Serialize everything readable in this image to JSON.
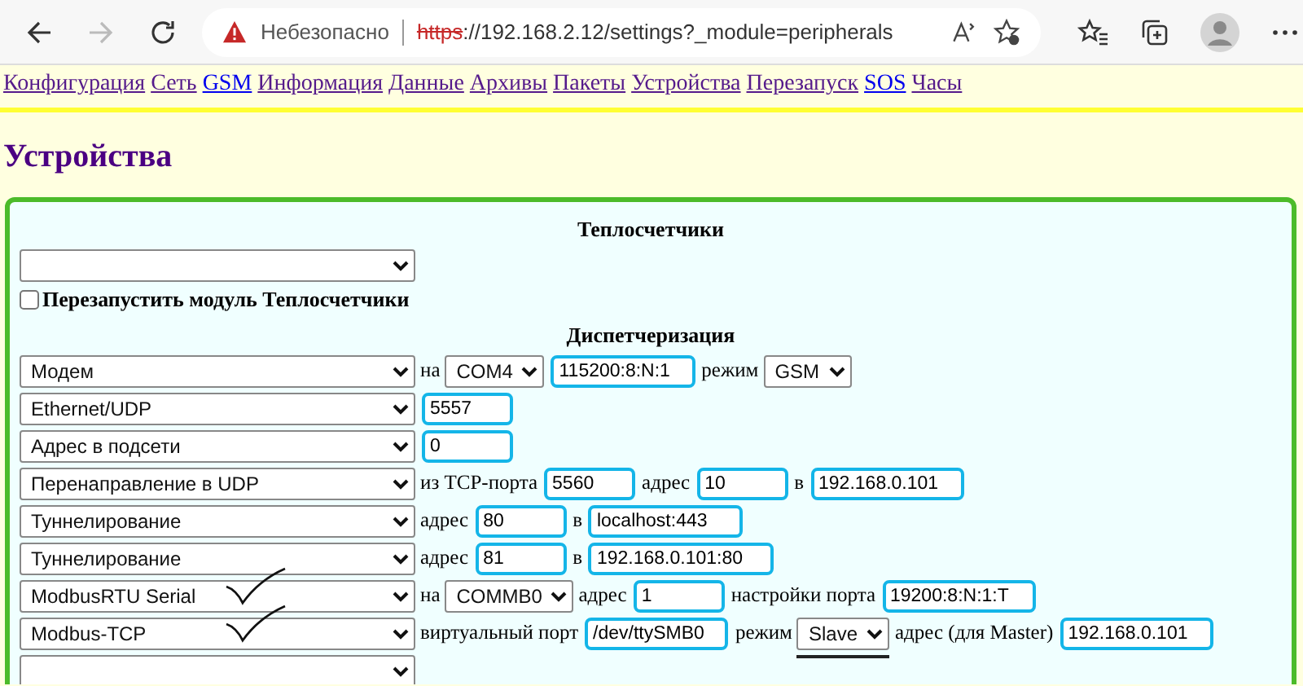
{
  "browser": {
    "security_label": "Небезопасно",
    "url_scheme": "https",
    "url_rest": "://192.168.2.12/settings?_module=peripherals"
  },
  "nav": [
    {
      "label": "Конфигурация",
      "visited": true
    },
    {
      "label": "Сеть",
      "visited": true
    },
    {
      "label": "GSM",
      "visited": false
    },
    {
      "label": "Информация",
      "visited": true
    },
    {
      "label": "Данные",
      "visited": true
    },
    {
      "label": "Архивы",
      "visited": true
    },
    {
      "label": "Пакеты",
      "visited": true
    },
    {
      "label": "Устройства",
      "visited": true
    },
    {
      "label": "Перезапуск",
      "visited": true
    },
    {
      "label": "SOS",
      "visited": false
    },
    {
      "label": "Часы",
      "visited": true
    }
  ],
  "heading": "Устройства",
  "meters": {
    "title": "Теплосчетчики",
    "restart_label": "Перезапустить модуль Теплосчетчики",
    "restart_checked": false
  },
  "dispatch": {
    "title": "Диспетчеризация",
    "rows": [
      {
        "device": "Модем",
        "check_mark": false,
        "parts": [
          {
            "kind": "label",
            "text": "на"
          },
          {
            "kind": "select",
            "value": "COM4",
            "underlined": false
          },
          {
            "kind": "input",
            "value": "115200:8:N:1"
          },
          {
            "kind": "label",
            "text": "режим"
          },
          {
            "kind": "select",
            "value": "GSM",
            "underlined": false
          }
        ]
      },
      {
        "device": "Ethernet/UDP",
        "check_mark": false,
        "parts": [
          {
            "kind": "input",
            "value": "5557"
          }
        ]
      },
      {
        "device": "Адрес в подсети",
        "check_mark": false,
        "parts": [
          {
            "kind": "input",
            "value": "0"
          }
        ]
      },
      {
        "device": "Перенаправление в UDP",
        "check_mark": false,
        "parts": [
          {
            "kind": "label",
            "text": "из TCP-порта"
          },
          {
            "kind": "input",
            "value": "5560"
          },
          {
            "kind": "label",
            "text": "адрес"
          },
          {
            "kind": "input",
            "value": "10"
          },
          {
            "kind": "label",
            "text": "в"
          },
          {
            "kind": "input",
            "value": "192.168.0.101"
          }
        ]
      },
      {
        "device": "Туннелирование",
        "check_mark": false,
        "parts": [
          {
            "kind": "label",
            "text": "адрес"
          },
          {
            "kind": "input",
            "value": "80"
          },
          {
            "kind": "label",
            "text": "в"
          },
          {
            "kind": "input",
            "value": "localhost:443"
          }
        ]
      },
      {
        "device": "Туннелирование",
        "check_mark": false,
        "parts": [
          {
            "kind": "label",
            "text": "адрес"
          },
          {
            "kind": "input",
            "value": "81"
          },
          {
            "kind": "label",
            "text": "в"
          },
          {
            "kind": "input",
            "value": "192.168.0.101:80"
          }
        ]
      },
      {
        "device": "ModbusRTU Serial",
        "check_mark": true,
        "parts": [
          {
            "kind": "label",
            "text": "на"
          },
          {
            "kind": "select",
            "value": "COMMB0",
            "underlined": false
          },
          {
            "kind": "label",
            "text": "адрес"
          },
          {
            "kind": "input",
            "value": "1"
          },
          {
            "kind": "label",
            "text": "настройки порта"
          },
          {
            "kind": "input",
            "value": "19200:8:N:1:T"
          }
        ]
      },
      {
        "device": "Modbus-TCP",
        "check_mark": true,
        "parts": [
          {
            "kind": "label",
            "text": "виртуальный порт"
          },
          {
            "kind": "input",
            "value": "/dev/ttySMB0"
          },
          {
            "kind": "label",
            "text": "режим"
          },
          {
            "kind": "select",
            "value": "Slave",
            "underlined": true
          },
          {
            "kind": "label",
            "text": "адрес (для Master)"
          },
          {
            "kind": "input",
            "value": "192.168.0.101"
          }
        ]
      },
      {
        "device": "",
        "check_mark": false,
        "parts": []
      }
    ]
  }
}
